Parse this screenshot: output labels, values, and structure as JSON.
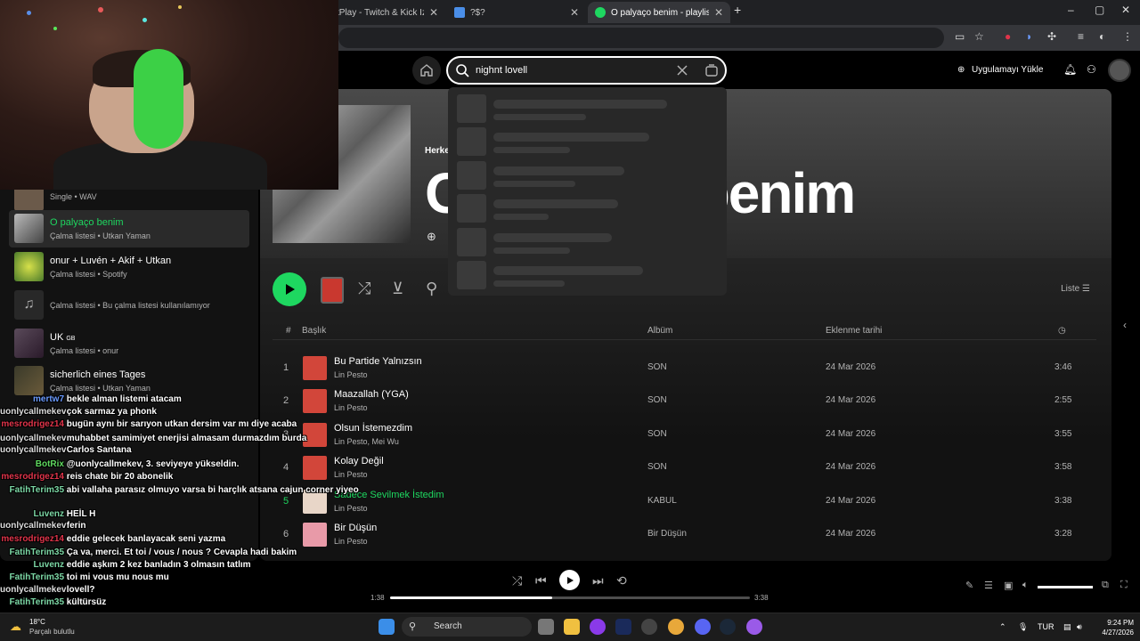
{
  "browser": {
    "tabs": [
      {
        "title": "tPlay - Twitch & Kick İzleyici",
        "close": "✕"
      },
      {
        "title": "?$?",
        "close": "✕"
      },
      {
        "title": "O palyaço benim - playlist by U",
        "close": "✕"
      }
    ],
    "new_tab": "+",
    "window_controls": [
      "–",
      "▢",
      "✕"
    ]
  },
  "topbar": {
    "search_value": "nighnt lovell",
    "install_label": "Uygulamayı Yükle"
  },
  "hero": {
    "type_label": "Herke",
    "title": "O palyaço benim"
  },
  "actions": {
    "list_label": "Liste"
  },
  "table": {
    "headers": {
      "num": "#",
      "title": "Başlık",
      "album": "Albüm",
      "date": "Eklenme tarihi"
    },
    "rows": [
      {
        "num": "1",
        "title": "Bu Partide Yalnızsın",
        "artist": "Lin Pesto",
        "album": "SON",
        "date": "24 Mar 2026",
        "dur": "3:46"
      },
      {
        "num": "2",
        "title": "Maazallah (YGA)",
        "artist": "Lin Pesto",
        "album": "SON",
        "date": "24 Mar 2026",
        "dur": "2:55"
      },
      {
        "num": "3",
        "title": "Olsun İstemezdim",
        "artist": "Lin Pesto, Mei Wu",
        "album": "SON",
        "date": "24 Mar 2026",
        "dur": "3:55"
      },
      {
        "num": "4",
        "title": "Kolay Değil",
        "artist": "Lin Pesto",
        "album": "SON",
        "date": "24 Mar 2026",
        "dur": "3:58"
      },
      {
        "num": "5",
        "title": "Sadece Sevilmek İstedim",
        "artist": "Lin Pesto",
        "album": "KABUL",
        "date": "24 Mar 2026",
        "dur": "3:38"
      },
      {
        "num": "6",
        "title": "Bir Düşün",
        "artist": "Lin Pesto",
        "album": "Bir Düşün",
        "date": "24 Mar 2026",
        "dur": "3:28"
      }
    ]
  },
  "sidebar": {
    "items": [
      {
        "title": "",
        "sub": "Single • WAV"
      },
      {
        "title": "O palyaço benim",
        "sub": "Çalma listesi • Utkan Yaman"
      },
      {
        "title": "onur + Luvén + Akif + Utkan",
        "sub": "Çalma listesi • Spotify"
      },
      {
        "title": "",
        "sub": "Çalma listesi • Bu çalma listesi kullanılamıyor"
      },
      {
        "title": "UK",
        "badge": "GB",
        "sub": "Çalma listesi • onur"
      },
      {
        "title": "sicherlich eines Tages",
        "sub": "Çalma listesi • Utkan Yaman"
      }
    ]
  },
  "player": {
    "elapsed": "1:38",
    "total": "3:38",
    "progress": 0.45,
    "volume": 1.0
  },
  "chat": {
    "lines": [
      {
        "user": "mertw7",
        "msg": "bekle alman listemi atacam",
        "color": "#6b9bff"
      },
      {
        "user": "uonlycallmekev",
        "msg": "çok sarmaz ya phonk",
        "color": "#dcdcdc"
      },
      {
        "user": "mesrodrigez14",
        "msg": "bugün aynı bir sarıyon utkan dersim var mı diye acaba",
        "color": "#e0344a"
      },
      {
        "user": "uonlycallmekev",
        "msg": "muhabbet samimiyet enerjisi almasam durmazdım burda",
        "color": "#dcdcdc"
      },
      {
        "user": "uonlycallmekev",
        "msg": "Carlos Santana",
        "color": "#dcdcdc"
      },
      {
        "user": "BotRix",
        "msg": "@uonlycallmekev, 3. seviyeye yükseldin.",
        "color": "#5fd85f"
      },
      {
        "user": "mesrodrigez14",
        "msg": "reis chate bir 20 abonelik",
        "color": "#e0344a"
      },
      {
        "user": "FatihTerim35",
        "msg": "abi vallaha parasız olmuyo varsa bi harçlık atsana cajun corner yiyeo",
        "color": "#7bd6a4"
      },
      {
        "user": "Luvenz",
        "msg": "HEİL H",
        "color": "#7bd6a4"
      },
      {
        "user": "uonlycallmekev",
        "msg": "ferin",
        "color": "#dcdcdc"
      },
      {
        "user": "mesrodrigez14",
        "msg": "eddie gelecek banlayacak seni yazma",
        "color": "#e0344a"
      },
      {
        "user": "FatihTerim35",
        "msg": "Ça va, merci. Et toi / vous / nous ? Cevapla hadi bakim",
        "color": "#7bd6a4"
      },
      {
        "user": "Luvenz",
        "msg": "eddie aşkım 2 kez banladın 3 olmasın tatlım",
        "color": "#7bd6a4"
      },
      {
        "user": "FatihTerim35",
        "msg": "toi mi vous mu nous mu",
        "color": "#7bd6a4"
      },
      {
        "user": "uonlycallmekev",
        "msg": "lovell?",
        "color": "#dcdcdc"
      },
      {
        "user": "FatihTerim35",
        "msg": "kültürsüz",
        "color": "#7bd6a4"
      }
    ]
  },
  "taskbar": {
    "temp": "18°C",
    "weather": "Parçalı bulutlu",
    "search_label": "Search",
    "lang": "TUR",
    "time": "9:24 PM",
    "date": "4/27/2026"
  }
}
